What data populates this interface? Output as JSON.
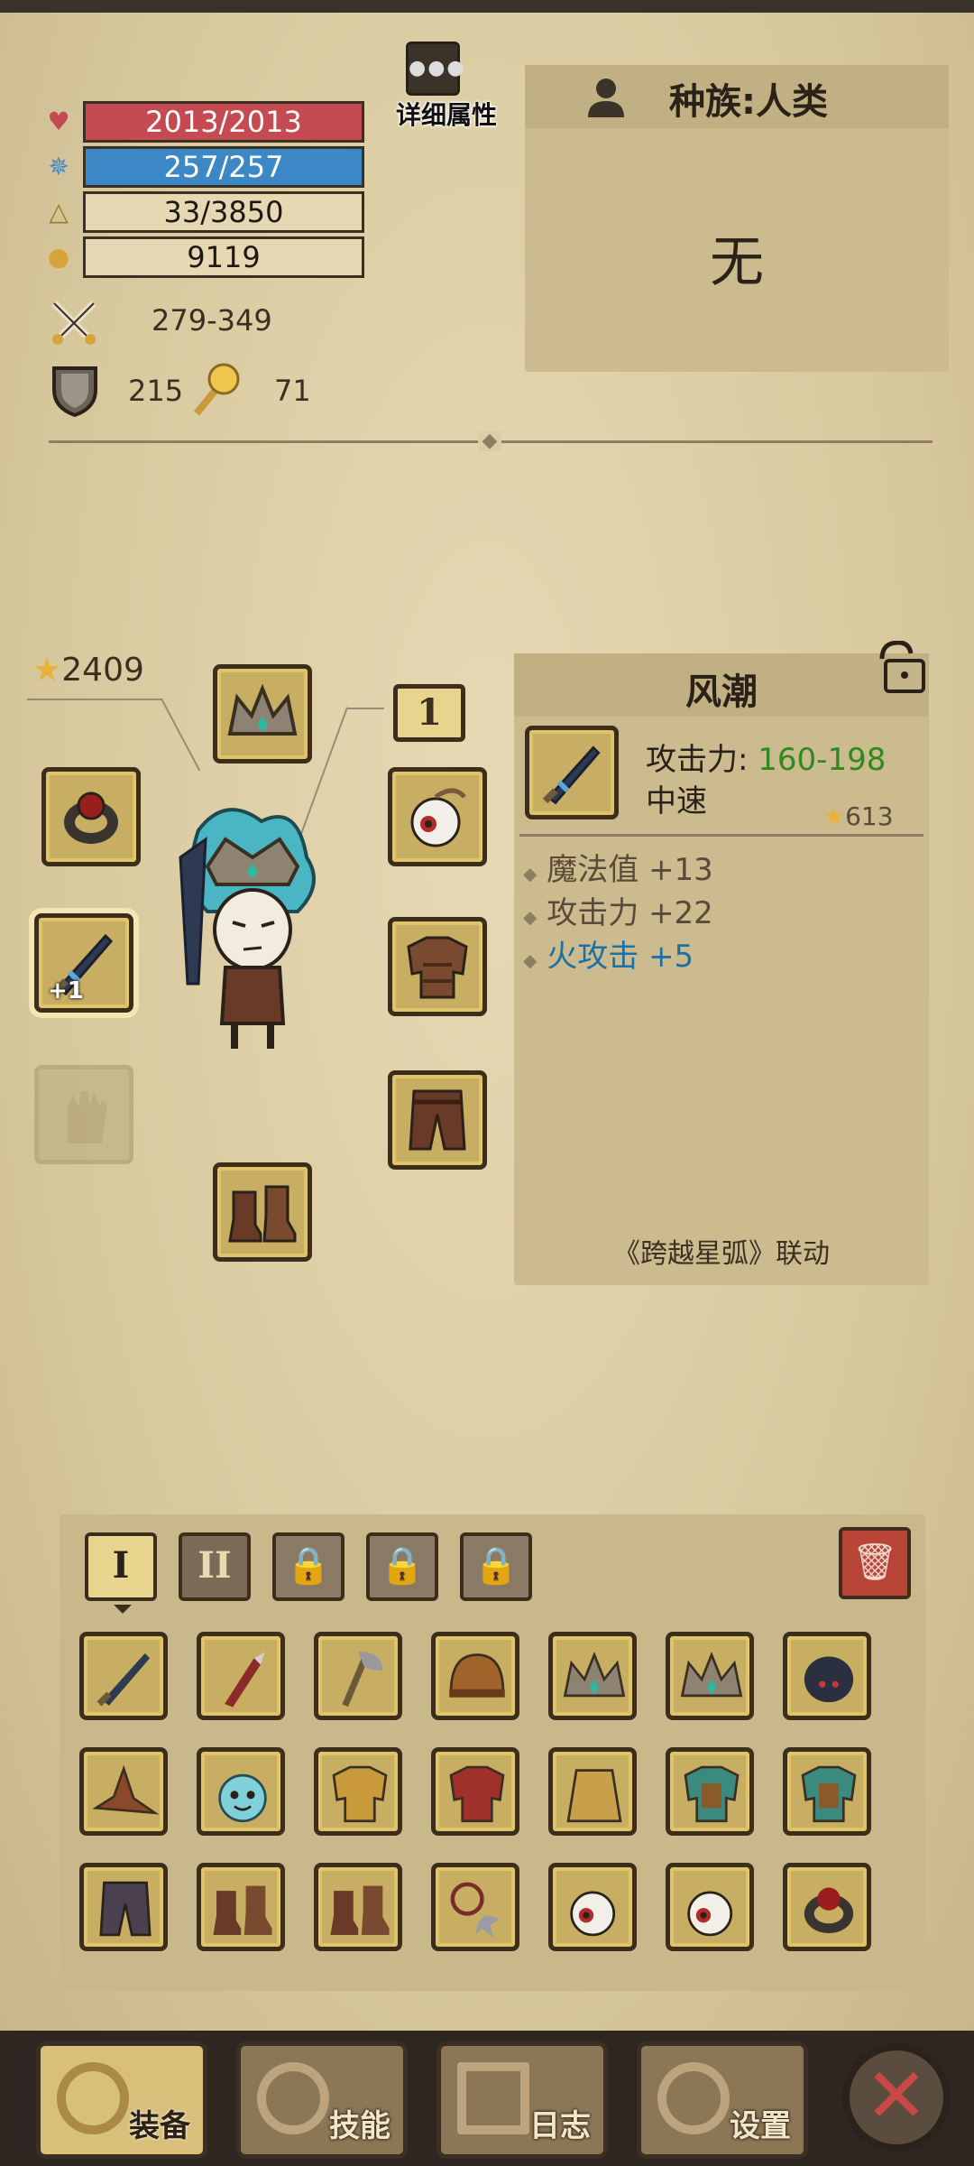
{
  "stats": {
    "hp": "2013/2013",
    "mp": "257/257",
    "exp": "33/3850",
    "gold": "9119",
    "attack": "279-349",
    "defense": "215",
    "magic": "71"
  },
  "detail_button": {
    "label": "详细属性"
  },
  "race": {
    "title": "种族:人类",
    "value": "无"
  },
  "character": {
    "power": "2409",
    "level": "1"
  },
  "item": {
    "name": "风潮",
    "attack_label": "攻击力:",
    "attack_value": "160-198",
    "speed": "中速",
    "score": "613",
    "attributes": [
      {
        "label": "魔法值",
        "value": "+13",
        "kind": "normal"
      },
      {
        "label": "攻击力",
        "value": "+22",
        "kind": "normal"
      },
      {
        "label": "火攻击",
        "value": "+5",
        "kind": "element"
      }
    ],
    "collab": "《跨越星弧》联动"
  },
  "weapon_slot_badge": "+1",
  "inventory": {
    "tabs": [
      {
        "label": "I",
        "state": "active"
      },
      {
        "label": "II",
        "state": "normal"
      },
      {
        "label": "",
        "state": "locked"
      },
      {
        "label": "",
        "state": "locked"
      },
      {
        "label": "",
        "state": "locked"
      }
    ],
    "items": [
      "sword",
      "spear",
      "axe",
      "helmet",
      "crown",
      "crown",
      "spider-helmet",
      "witch-hat",
      "slime-pet",
      "golden-armor",
      "red-armor",
      "straw-cape",
      "teal-armor",
      "teal-armor",
      "dark-pants",
      "boots",
      "boots",
      "chain-flail",
      "eyeball",
      "eyeball",
      "ring"
    ]
  },
  "nav": [
    {
      "label": "装备",
      "active": true
    },
    {
      "label": "技能",
      "active": false
    },
    {
      "label": "日志",
      "active": false
    },
    {
      "label": "设置",
      "active": false
    }
  ],
  "colors": {
    "hp": "#c54a52",
    "mp": "#3c87c5",
    "gold_frame": "#e0c46a",
    "green": "#2f8a1e",
    "blue": "#1e6fa5"
  }
}
